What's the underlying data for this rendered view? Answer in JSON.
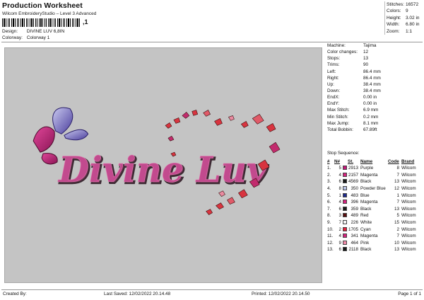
{
  "header": {
    "title": "Production Worksheet",
    "software": "Wilcom EmbroideryStudio – Level 3 Advanced",
    "barcode_mark": ",1",
    "design_label": "Design:",
    "design_value": "DIVINE LUV 6,8IN",
    "colorway_label": "Colorway:",
    "colorway_value": "Colorway 1"
  },
  "stats": [
    {
      "label": "Stitches:",
      "value": "16572"
    },
    {
      "label": "Colors:",
      "value": "9"
    },
    {
      "label": "Height:",
      "value": "3.02 in"
    },
    {
      "label": "Width:",
      "value": "6.80 in"
    },
    {
      "label": "Zoom:",
      "value": "1:1"
    }
  ],
  "design": {
    "text": "Divine Luv",
    "background": "#c4c4c4"
  },
  "machine_info": [
    {
      "label": "Machine:",
      "value": "Tajima"
    },
    {
      "label": "Color changes:",
      "value": "12"
    },
    {
      "label": "Stops:",
      "value": "13"
    },
    {
      "label": "Trims:",
      "value": "90"
    },
    {
      "label": "Left:",
      "value": "86.4 mm"
    },
    {
      "label": "Right:",
      "value": "86.4 mm"
    },
    {
      "label": "Up:",
      "value": "38.4 mm"
    },
    {
      "label": "Down:",
      "value": "38.4 mm"
    },
    {
      "label": "EndX:",
      "value": "0.00 in"
    },
    {
      "label": "EndY:",
      "value": "0.00 in"
    },
    {
      "label": "Max Stitch:",
      "value": "6.9 mm"
    },
    {
      "label": "Min Stitch:",
      "value": "0.2 mm"
    },
    {
      "label": "Max Jump:",
      "value": "8.1 mm"
    },
    {
      "label": "Total Bobbin:",
      "value": "67.89ft"
    }
  ],
  "stop_sequence": {
    "title": "Stop Sequence:",
    "columns": [
      "#",
      "N#",
      "",
      "St.",
      "Name",
      "Code",
      "Brand"
    ],
    "rows": [
      {
        "num": "1.",
        "n": "5",
        "color": "#c2187a",
        "st": "2913",
        "name": "Purple",
        "code": "8",
        "brand": "Wilcom"
      },
      {
        "num": "2.",
        "n": "4",
        "color": "#d4237d",
        "st": "2157",
        "name": "Magenta",
        "code": "7",
        "brand": "Wilcom"
      },
      {
        "num": "3.",
        "n": "6",
        "color": "#1a1a1a",
        "st": "4569",
        "name": "Black",
        "code": "13",
        "brand": "Wilcom"
      },
      {
        "num": "4.",
        "n": "8",
        "color": "#b9c4e6",
        "st": "350",
        "name": "Powder Blue",
        "code": "12",
        "brand": "Wilcom"
      },
      {
        "num": "5.",
        "n": "1",
        "color": "#1e2a8c",
        "st": "483",
        "name": "Blue",
        "code": "1",
        "brand": "Wilcom"
      },
      {
        "num": "6.",
        "n": "4",
        "color": "#d4237d",
        "st": "396",
        "name": "Magenta",
        "code": "7",
        "brand": "Wilcom"
      },
      {
        "num": "7.",
        "n": "6",
        "color": "#1a1a1a",
        "st": "359",
        "name": "Black",
        "code": "13",
        "brand": "Wilcom"
      },
      {
        "num": "8.",
        "n": "3",
        "color": "#5a1010",
        "st": "489",
        "name": "Red",
        "code": "5",
        "brand": "Wilcom"
      },
      {
        "num": "9.",
        "n": "7",
        "color": "#f4f4f4",
        "st": "226",
        "name": "White",
        "code": "15",
        "brand": "Wilcom"
      },
      {
        "num": "10.",
        "n": "2",
        "color": "#e0203a",
        "st": "1705",
        "name": "Cyan",
        "code": "2",
        "brand": "Wilcom"
      },
      {
        "num": "11.",
        "n": "4",
        "color": "#d4237d",
        "st": "341",
        "name": "Magenta",
        "code": "7",
        "brand": "Wilcom"
      },
      {
        "num": "12.",
        "n": "9",
        "color": "#f08aa8",
        "st": "464",
        "name": "Pink",
        "code": "10",
        "brand": "Wilcom"
      },
      {
        "num": "13.",
        "n": "6",
        "color": "#1a1a1a",
        "st": "2118",
        "name": "Black",
        "code": "13",
        "brand": "Wilcom"
      }
    ]
  },
  "footer": {
    "created_by": "Created By:",
    "last_saved": "Last Saved: 12/02/2022 20.14.48",
    "printed": "Printed: 12/02/2022 20.14.50",
    "page": "Page 1 of 1"
  }
}
